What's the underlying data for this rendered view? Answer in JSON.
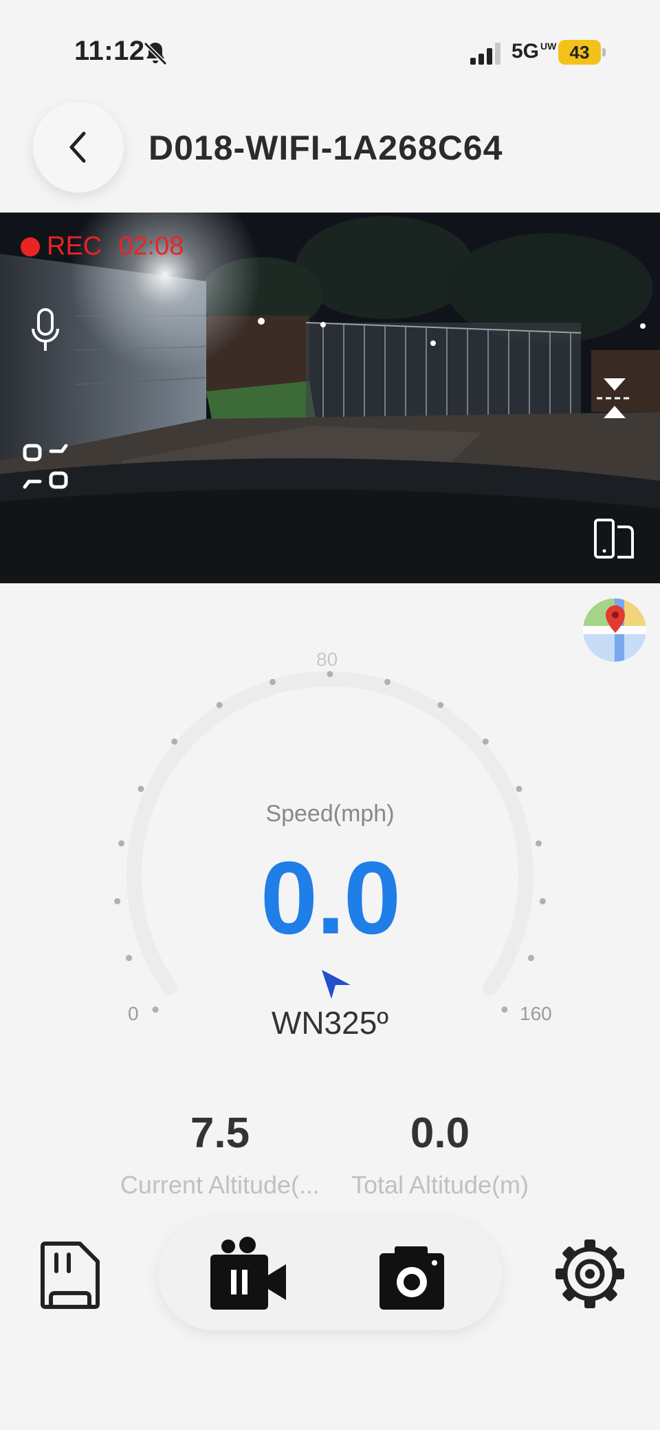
{
  "status_bar": {
    "time": "11:12",
    "network": "5G",
    "network_sup": "UW",
    "battery_level": "43"
  },
  "header": {
    "title": "D018-WIFI-1A268C64"
  },
  "video": {
    "rec_label": "REC",
    "rec_time": "02:08"
  },
  "gauge": {
    "speed_label": "Speed(mph)",
    "speed_value": "0.0",
    "heading": "WN325º",
    "min_label": "0",
    "mid_label": "80",
    "max_label": "160",
    "accent": "#1f7ee8"
  },
  "altitude": {
    "current_value": "7.5",
    "current_label": "Current Altitude(...",
    "total_value": "0.0",
    "total_label": "Total Altitude(m)"
  },
  "bottom_bar": {
    "icons": [
      "sd-card-icon",
      "pause-recording-icon",
      "camera-icon",
      "settings-gear-icon"
    ]
  },
  "colors": {
    "rec_red": "#ea2323",
    "battery_yellow": "#f2c21a"
  }
}
